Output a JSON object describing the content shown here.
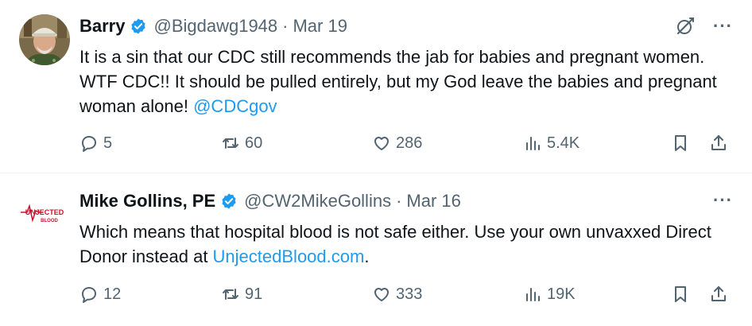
{
  "tweets": [
    {
      "name": "Barry",
      "handle": "@Bigdawg1948",
      "separator": "·",
      "date": "Mar 19",
      "text_before": "It is a sin that our CDC still recommends the jab for babies and pregnant women.  WTF CDC!! It should be pulled entirely, but my God leave the babies and pregnant woman alone!  ",
      "link_text": "@CDCgov",
      "text_after": "",
      "replies": "5",
      "retweets": "60",
      "likes": "286",
      "views": "5.4K",
      "more_label": "···"
    },
    {
      "name": "Mike Gollins, PE",
      "handle": "@CW2MikeGollins",
      "separator": "·",
      "date": "Mar 16",
      "text_before": "Which means that hospital blood is not safe either.  Use your own unvaxxed Direct Donor instead at ",
      "link_text": "UnjectedBlood.com",
      "text_after": ".",
      "replies": "12",
      "retweets": "91",
      "likes": "333",
      "views": "19K",
      "more_label": "···",
      "avatar_logo_top": "UNJECTED",
      "avatar_logo_bottom": "BLOOD"
    }
  ],
  "colors": {
    "text": "#0f1419",
    "secondary": "#536471",
    "link": "#1d9bf0",
    "verified": "#1d9bf0",
    "logo_red": "#c8102e"
  },
  "icons": [
    "verified-badge-icon",
    "grok-icon",
    "more-icon",
    "reply-icon",
    "retweet-icon",
    "like-icon",
    "views-icon",
    "bookmark-icon",
    "share-icon"
  ]
}
